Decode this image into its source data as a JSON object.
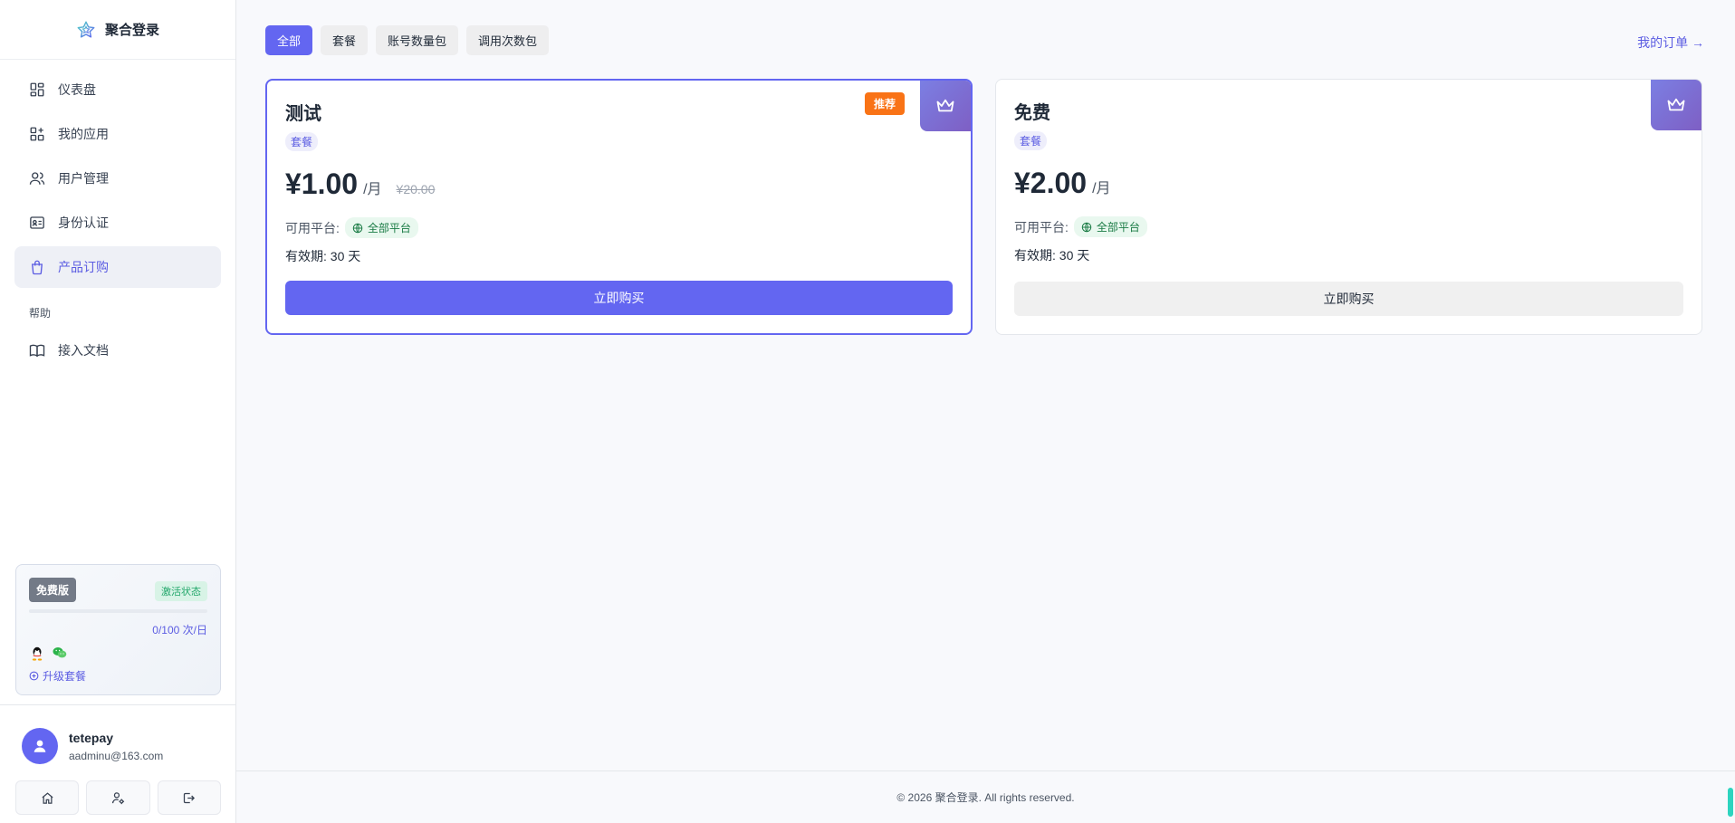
{
  "brand": {
    "name": "聚合登录",
    "icon": "star-icon"
  },
  "sidebar": {
    "items": [
      {
        "label": "仪表盘",
        "icon": "dashboard-icon"
      },
      {
        "label": "我的应用",
        "icon": "apps-icon"
      },
      {
        "label": "用户管理",
        "icon": "users-icon"
      },
      {
        "label": "身份认证",
        "icon": "id-card-icon"
      },
      {
        "label": "产品订购",
        "icon": "shopping-bag-icon"
      }
    ],
    "help_section": "帮助",
    "help_items": [
      {
        "label": "接入文档",
        "icon": "book-icon"
      }
    ]
  },
  "plan": {
    "badge": "免费版",
    "status": "激活状态",
    "usage": "0/100 次/日",
    "usage_fraction": 0,
    "upgrade": "升级套餐",
    "login_icons": [
      "qq-icon",
      "wechat-icon"
    ]
  },
  "user": {
    "name": "tetepay",
    "email": "aadminu@163.com"
  },
  "tabs": [
    {
      "label": "全部",
      "active": true
    },
    {
      "label": "套餐",
      "active": false
    },
    {
      "label": "账号数量包",
      "active": false
    },
    {
      "label": "调用次数包",
      "active": false
    }
  ],
  "orders_link": "我的订单 →",
  "cards": [
    {
      "title": "测试",
      "type": "套餐",
      "badge": "推荐",
      "price": "¥1.00",
      "unit": "/月",
      "original_price": "¥20.00",
      "platform_label": "可用平台:",
      "platform": "全部平台",
      "validity": "有效期: 30 天",
      "buy": "立即购买"
    },
    {
      "title": "免费",
      "type": "套餐",
      "price": "¥2.00",
      "unit": "/月",
      "platform_label": "可用平台:",
      "platform": "全部平台",
      "validity": "有效期: 30 天",
      "buy": "立即购买"
    }
  ],
  "footer": "© 2026 聚合登录. All rights reserved.",
  "colors": {
    "accent": "#6366f1",
    "recommend": "#f97316",
    "status_green": "#23a76b"
  }
}
